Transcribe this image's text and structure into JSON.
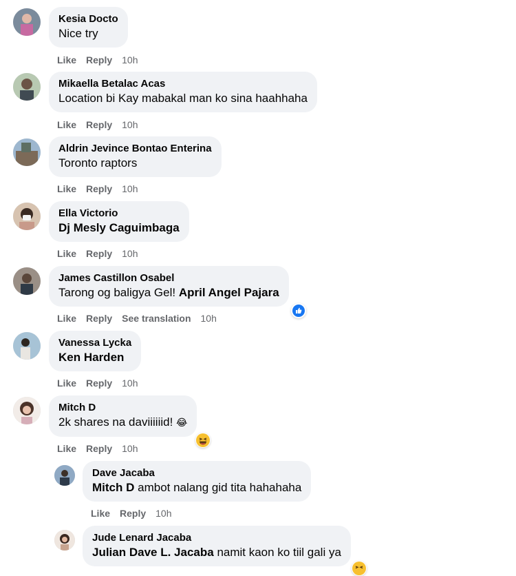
{
  "action_labels": {
    "like": "Like",
    "reply": "Reply",
    "translate": "See translation"
  },
  "comments": [
    {
      "name": "Kesia Docto",
      "text": "Nice try",
      "time": "10h"
    },
    {
      "name": "Mikaella Betalac Acas",
      "text": "Location bi Kay mabakal man ko sina haahhaha",
      "time": "10h"
    },
    {
      "name": "Aldrin Jevince Bontao Enterina",
      "text": "Toronto raptors",
      "time": "10h"
    },
    {
      "name": "Ella Victorio",
      "mention": "Dj Mesly Caguimbaga",
      "time": "10h"
    },
    {
      "name": "James Castillon Osabel",
      "text": "Tarong og baligya Gel!",
      "mention": "April Angel Pajara",
      "time": "10h",
      "reaction": "like-icon"
    },
    {
      "name": "Vanessa Lycka",
      "mention": "Ken Harden",
      "time": "10h"
    },
    {
      "name": "Mitch D",
      "text": "2k shares na daviiiiiid!",
      "time": "10h",
      "reaction": "haha-icon"
    }
  ],
  "replies": [
    {
      "name": "Dave Jacaba",
      "mention": "Mitch D",
      "text": "ambot nalang gid tita hahahaha",
      "time": "10h"
    },
    {
      "name": "Jude Lenard Jacaba",
      "mention": "Julian Dave L. Jacaba",
      "text": "namit kaon ko tiil gali ya"
    }
  ],
  "colors": {
    "bubble": "#f0f2f5",
    "meta": "#65676b",
    "like_blue": "#1877f2",
    "haha_yellow": "#f7c02f"
  }
}
